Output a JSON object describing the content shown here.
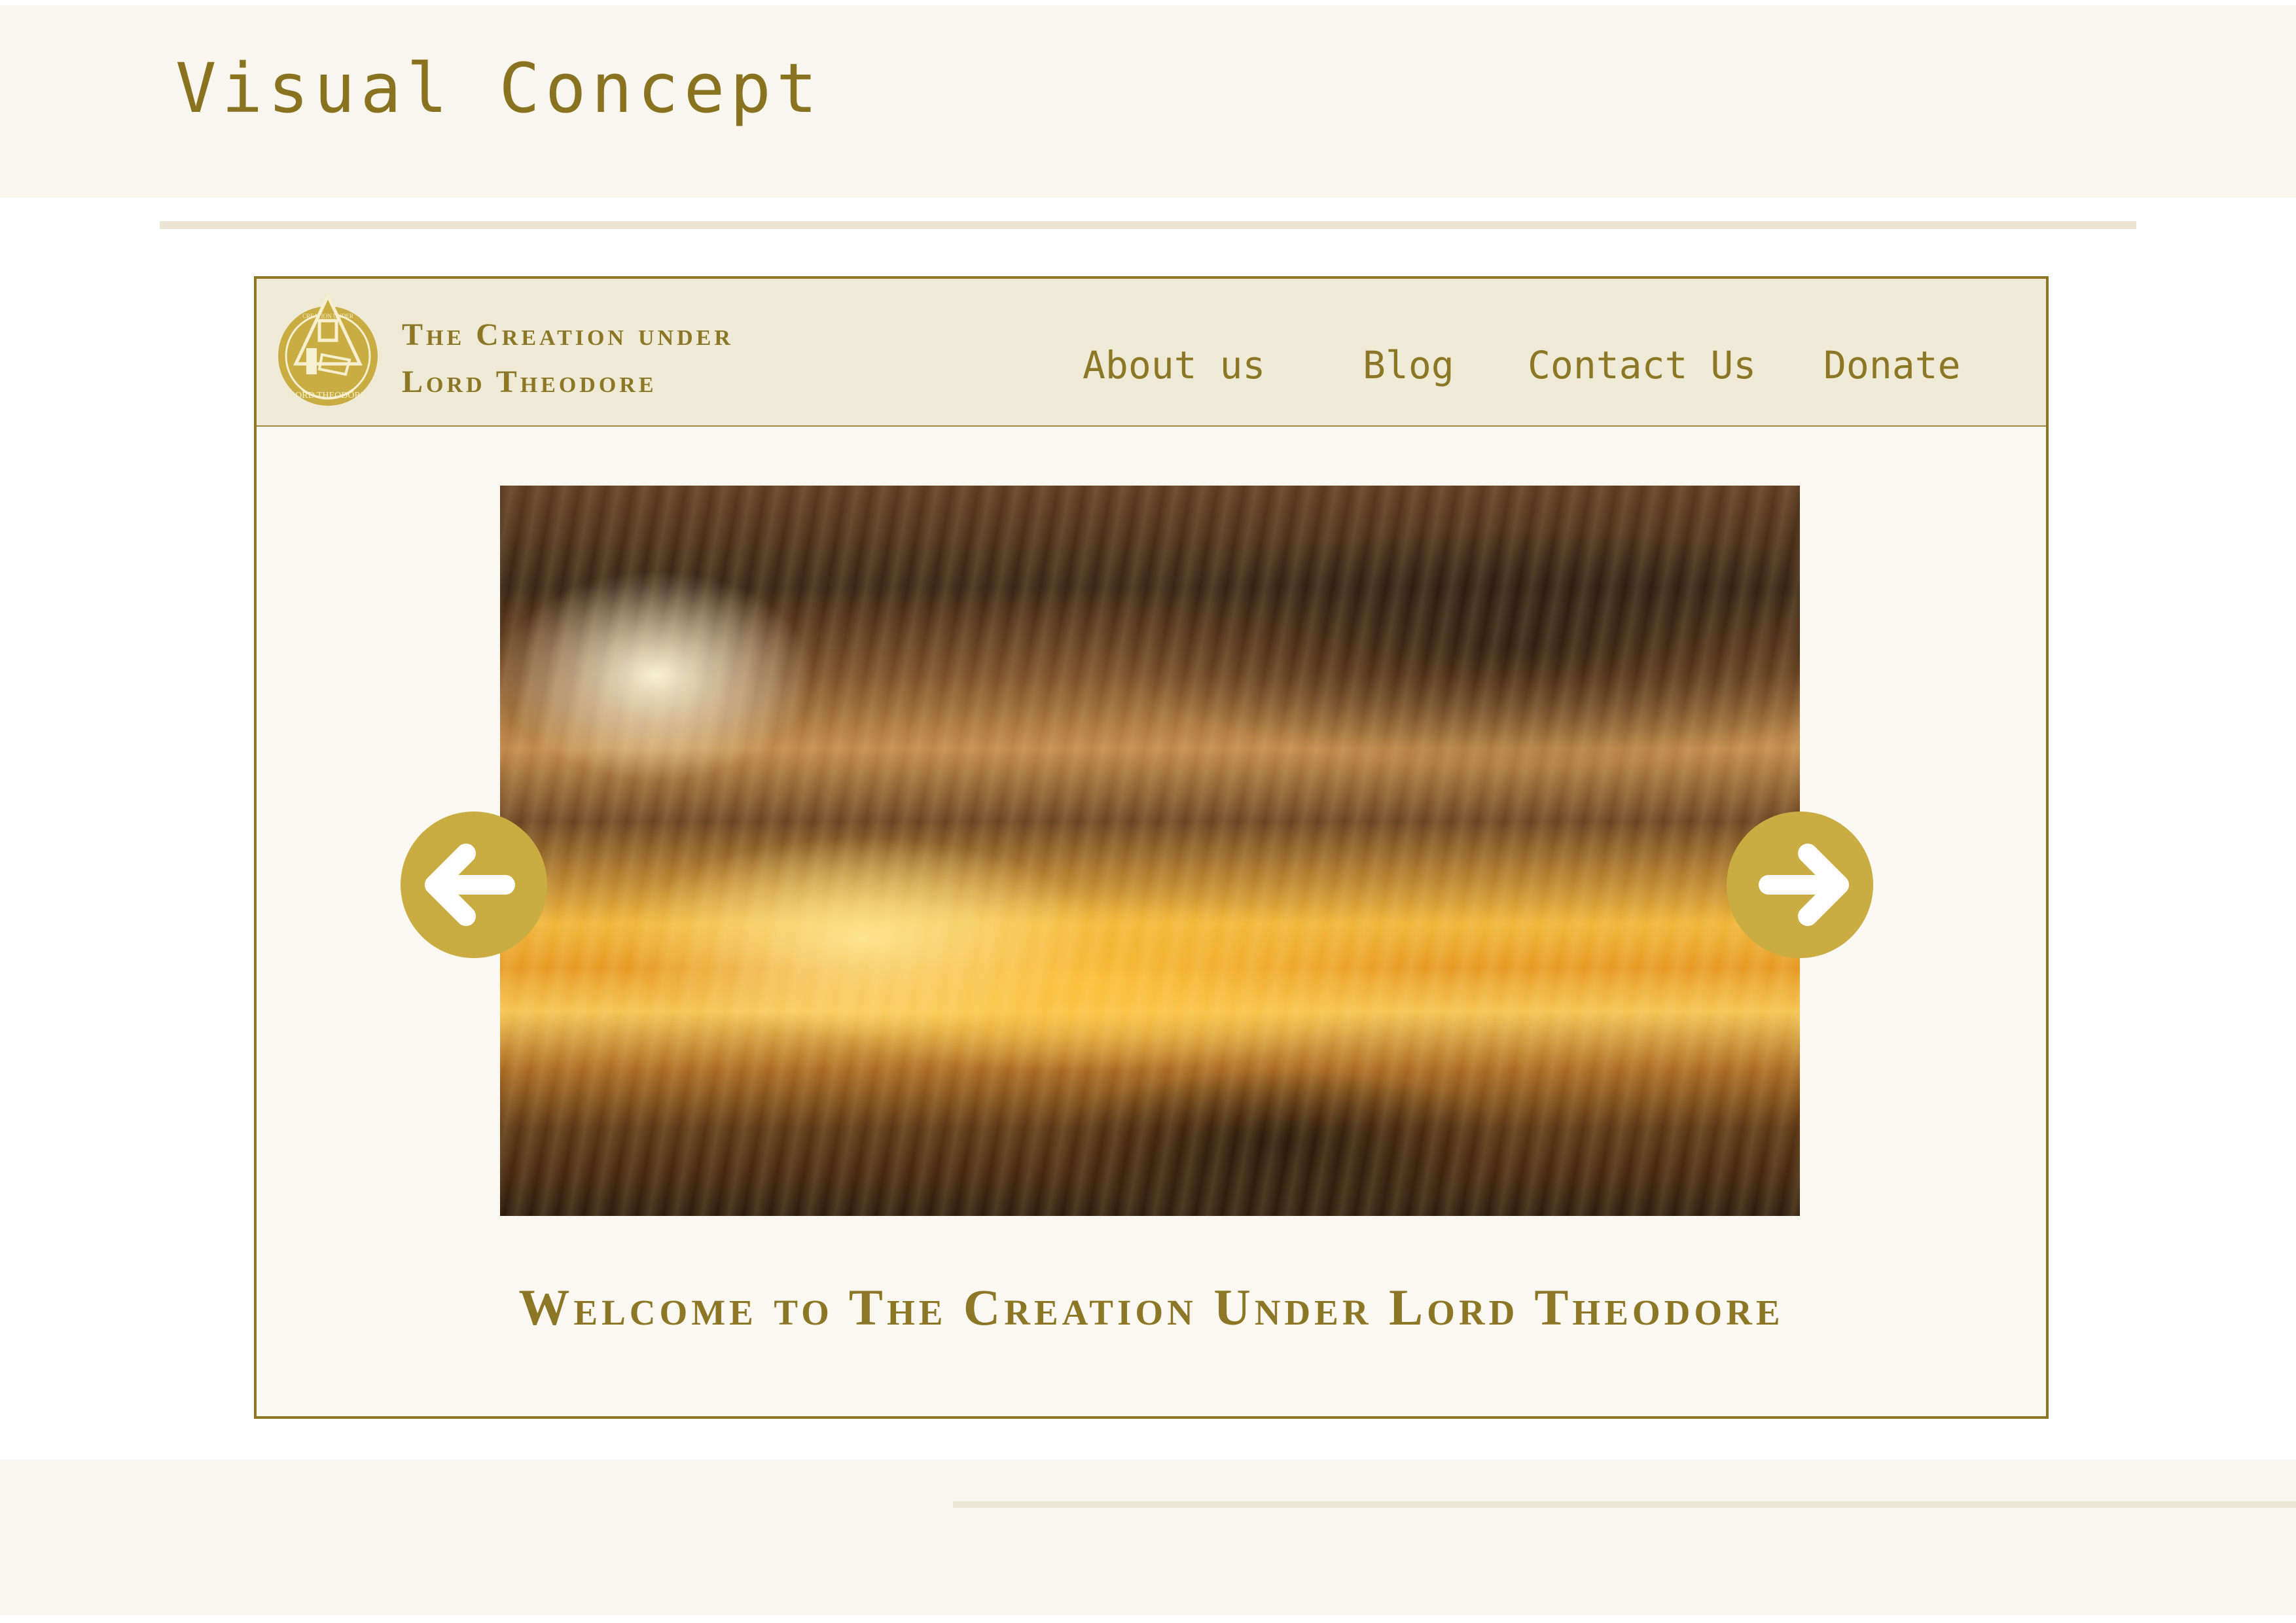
{
  "page": {
    "heading": "Visual Concept"
  },
  "site": {
    "brand_line1": "The Creation under",
    "brand_line2": "Lord Theodore",
    "logo_icon": "crest-logo-icon",
    "logo_text_top": "CREATION UNDER",
    "logo_text_bottom": "LORD THEODORE",
    "nav": [
      {
        "label": "About us"
      },
      {
        "label": "Blog"
      },
      {
        "label": "Contact Us"
      },
      {
        "label": "Donate"
      }
    ]
  },
  "carousel": {
    "slide_image": "golden sunset over clouds reflected in water",
    "prev_icon": "arrow-left-icon",
    "next_icon": "arrow-right-icon"
  },
  "main": {
    "welcome": "Welcome to The Creation Under Lord Theodore"
  },
  "colors": {
    "brand_gold": "#8c7726",
    "button_gold": "#c9ac42",
    "header_bg": "#eeead6",
    "panel_bg": "#faf8f1"
  }
}
